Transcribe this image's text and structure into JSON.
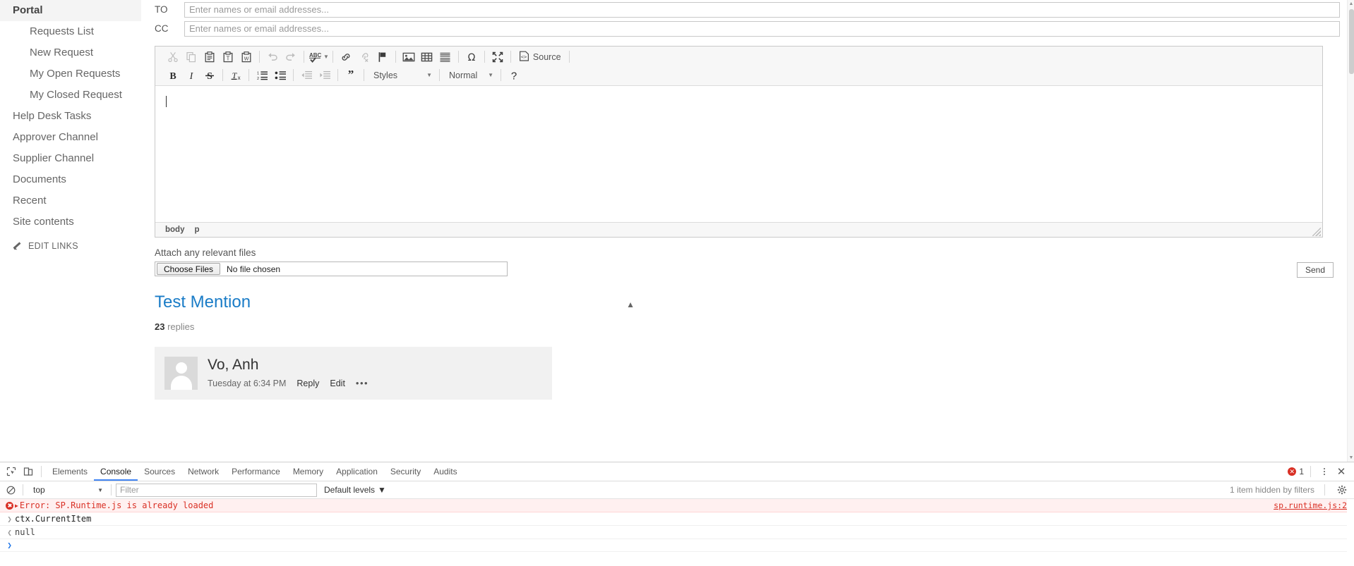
{
  "sidebar": {
    "header": "Portal",
    "items": [
      {
        "label": "Requests List",
        "child": true
      },
      {
        "label": "New Request",
        "child": true
      },
      {
        "label": "My Open Requests",
        "child": true
      },
      {
        "label": "My Closed Request",
        "child": true
      },
      {
        "label": "Help Desk Tasks",
        "child": false
      },
      {
        "label": "Approver Channel",
        "child": false
      },
      {
        "label": "Supplier Channel",
        "child": false
      },
      {
        "label": "Documents",
        "child": false
      },
      {
        "label": "Recent",
        "child": false
      },
      {
        "label": "Site contents",
        "child": false
      }
    ],
    "edit_links": "EDIT LINKS"
  },
  "compose": {
    "to_label": "TO",
    "cc_label": "CC",
    "to_value": "",
    "cc_value": "",
    "address_placeholder": "Enter names or email addresses...",
    "editor_body_text": "",
    "element_path": [
      "body",
      "p"
    ]
  },
  "editor_toolbar": {
    "row1": [
      {
        "name": "cut-icon",
        "title": "Cut",
        "disabled": true
      },
      {
        "name": "copy-icon",
        "title": "Copy",
        "disabled": true
      },
      {
        "name": "paste-icon",
        "title": "Paste",
        "disabled": false
      },
      {
        "name": "paste-text-icon",
        "title": "Paste as plain text",
        "disabled": false
      },
      {
        "name": "paste-from-word-icon",
        "title": "Paste from Word",
        "disabled": false
      },
      {
        "name": "undo-icon",
        "title": "Undo",
        "disabled": true
      },
      {
        "name": "redo-icon",
        "title": "Redo",
        "disabled": true
      },
      {
        "name": "spellcheck-icon",
        "title": "Spell Check As You Type",
        "disabled": false
      },
      {
        "name": "link-icon",
        "title": "Link",
        "disabled": false
      },
      {
        "name": "unlink-icon",
        "title": "Unlink",
        "disabled": true
      },
      {
        "name": "anchor-flag-icon",
        "title": "Anchor",
        "disabled": false
      },
      {
        "name": "image-icon",
        "title": "Image",
        "disabled": false
      },
      {
        "name": "table-icon",
        "title": "Table",
        "disabled": false
      },
      {
        "name": "horizontal-rule-icon",
        "title": "Horizontal Line",
        "disabled": false
      },
      {
        "name": "special-character-icon",
        "title": "Insert Special Character",
        "disabled": false
      },
      {
        "name": "maximize-icon",
        "title": "Maximize",
        "disabled": false
      }
    ],
    "source_label": "Source",
    "row2": [
      {
        "name": "bold-icon",
        "title": "Bold",
        "disabled": false
      },
      {
        "name": "italic-icon",
        "title": "Italic",
        "disabled": false
      },
      {
        "name": "strikethrough-icon",
        "title": "Strikethrough",
        "disabled": false
      },
      {
        "name": "remove-format-icon",
        "title": "Remove Format",
        "disabled": false
      },
      {
        "name": "numbered-list-icon",
        "title": "Insert/Remove Numbered List",
        "disabled": false
      },
      {
        "name": "bulleted-list-icon",
        "title": "Insert/Remove Bulleted List",
        "disabled": false
      },
      {
        "name": "outdent-icon",
        "title": "Decrease Indent",
        "disabled": true
      },
      {
        "name": "indent-icon",
        "title": "Increase Indent",
        "disabled": true
      },
      {
        "name": "blockquote-icon",
        "title": "Block Quote",
        "disabled": false
      },
      {
        "name": "help-icon",
        "title": "About CKEditor",
        "disabled": false
      }
    ],
    "styles_label": "Styles",
    "format_label": "Normal"
  },
  "attach": {
    "label": "Attach any relevant files",
    "choose_button": "Choose Files",
    "no_file_text": "No file chosen",
    "send_button": "Send"
  },
  "conversation": {
    "title": "Test Mention",
    "replies_count": "23",
    "replies_word": "replies",
    "post": {
      "author": "Vo, Anh",
      "timestamp": "Tuesday at 6:34 PM",
      "reply_label": "Reply",
      "edit_label": "Edit",
      "more_label": "•••"
    }
  },
  "devtools": {
    "tabs": [
      {
        "label": "Elements",
        "active": false
      },
      {
        "label": "Console",
        "active": true
      },
      {
        "label": "Sources",
        "active": false
      },
      {
        "label": "Network",
        "active": false
      },
      {
        "label": "Performance",
        "active": false
      },
      {
        "label": "Memory",
        "active": false
      },
      {
        "label": "Application",
        "active": false
      },
      {
        "label": "Security",
        "active": false
      },
      {
        "label": "Audits",
        "active": false
      }
    ],
    "error_count": "1",
    "context_selector": "top",
    "filter_placeholder": "Filter",
    "filter_value": "",
    "levels_label": "Default levels",
    "hidden_message": "1 item hidden by filters",
    "console_rows": [
      {
        "kind": "error",
        "text": "Error: SP.Runtime.js is already loaded",
        "source": "sp.runtime.js:2"
      },
      {
        "kind": "input",
        "text": "ctx.CurrentItem",
        "source": ""
      },
      {
        "kind": "output",
        "text": "null",
        "source": ""
      },
      {
        "kind": "prompt",
        "text": "",
        "source": ""
      }
    ]
  },
  "colors": {
    "accent_blue": "#1a7cc7",
    "devtools_active": "#4285f4",
    "error_red": "#d93025"
  }
}
